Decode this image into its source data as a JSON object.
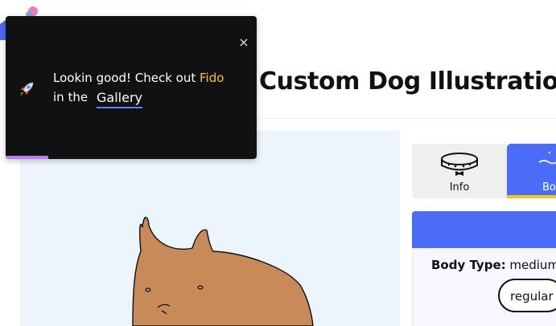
{
  "page": {
    "title": "Custom Dog Illustration"
  },
  "toast": {
    "line1_prefix": "Lookin good! Check out ",
    "dog_name": "Fido",
    "line2_prefix": "in the",
    "gallery_link": "Gallery",
    "close_symbol": "×",
    "icon": "rocket-icon",
    "progress_fraction": 0.17,
    "colors": {
      "background": "#111111",
      "highlight": "#f5c518",
      "progress": "#b57ff0"
    }
  },
  "tabs": [
    {
      "label": "Info",
      "icon": "collar-icon",
      "active": false
    },
    {
      "label": "Bo",
      "icon": "body-icon",
      "active": true
    }
  ],
  "body_panel": {
    "body_type_label": "Body Type:",
    "body_type_value": "medium",
    "option_selected": "regular"
  },
  "colors": {
    "accent": "#4a6cf7",
    "canvas_bg": "#ecf5fc",
    "dog_fill": "#c98a5a",
    "tab_underline": "#f5c518"
  }
}
